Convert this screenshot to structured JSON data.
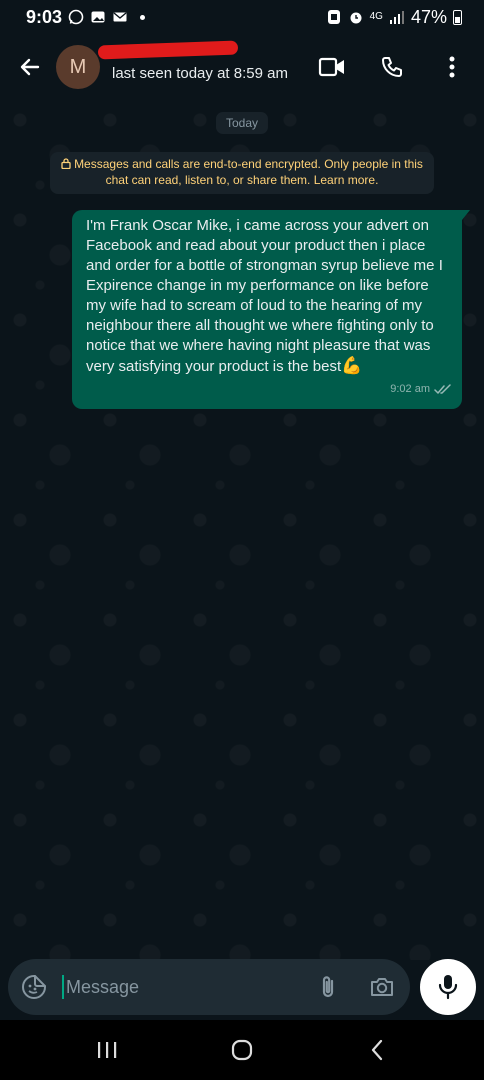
{
  "status_bar": {
    "time": "9:03",
    "network": "4G",
    "battery": "47%"
  },
  "header": {
    "avatar_letter": "M",
    "contact_status": "last seen today at 8:59 am"
  },
  "chat": {
    "date_divider": "Today",
    "encryption_notice": "Messages and calls are end-to-end encrypted. Only people in this chat can read, listen to, or share them. Learn more.",
    "message": {
      "text": "I'm  Frank Oscar Mike, i came across your advert on Facebook and read about your product then i place and order for a bottle of strongman syrup believe me I Expirence change in my performance on like before my wife had to scream of loud to the hearing of my neighbour there all thought we where fighting only to notice that we where having night pleasure that was very satisfying your product is the best",
      "emoji": "💪",
      "time": "9:02 am"
    }
  },
  "composer": {
    "placeholder": "Message"
  },
  "colors": {
    "background": "#0b141a",
    "outgoing_bubble": "#005c4b",
    "accent": "#00a884",
    "encryption_text": "#ffd279"
  },
  "icons": {
    "back": "arrow-left-icon",
    "video": "video-call-icon",
    "call": "phone-icon",
    "menu": "more-vert-icon",
    "sticker": "sticker-icon",
    "attach": "paperclip-icon",
    "camera": "camera-icon",
    "mic": "microphone-icon"
  }
}
